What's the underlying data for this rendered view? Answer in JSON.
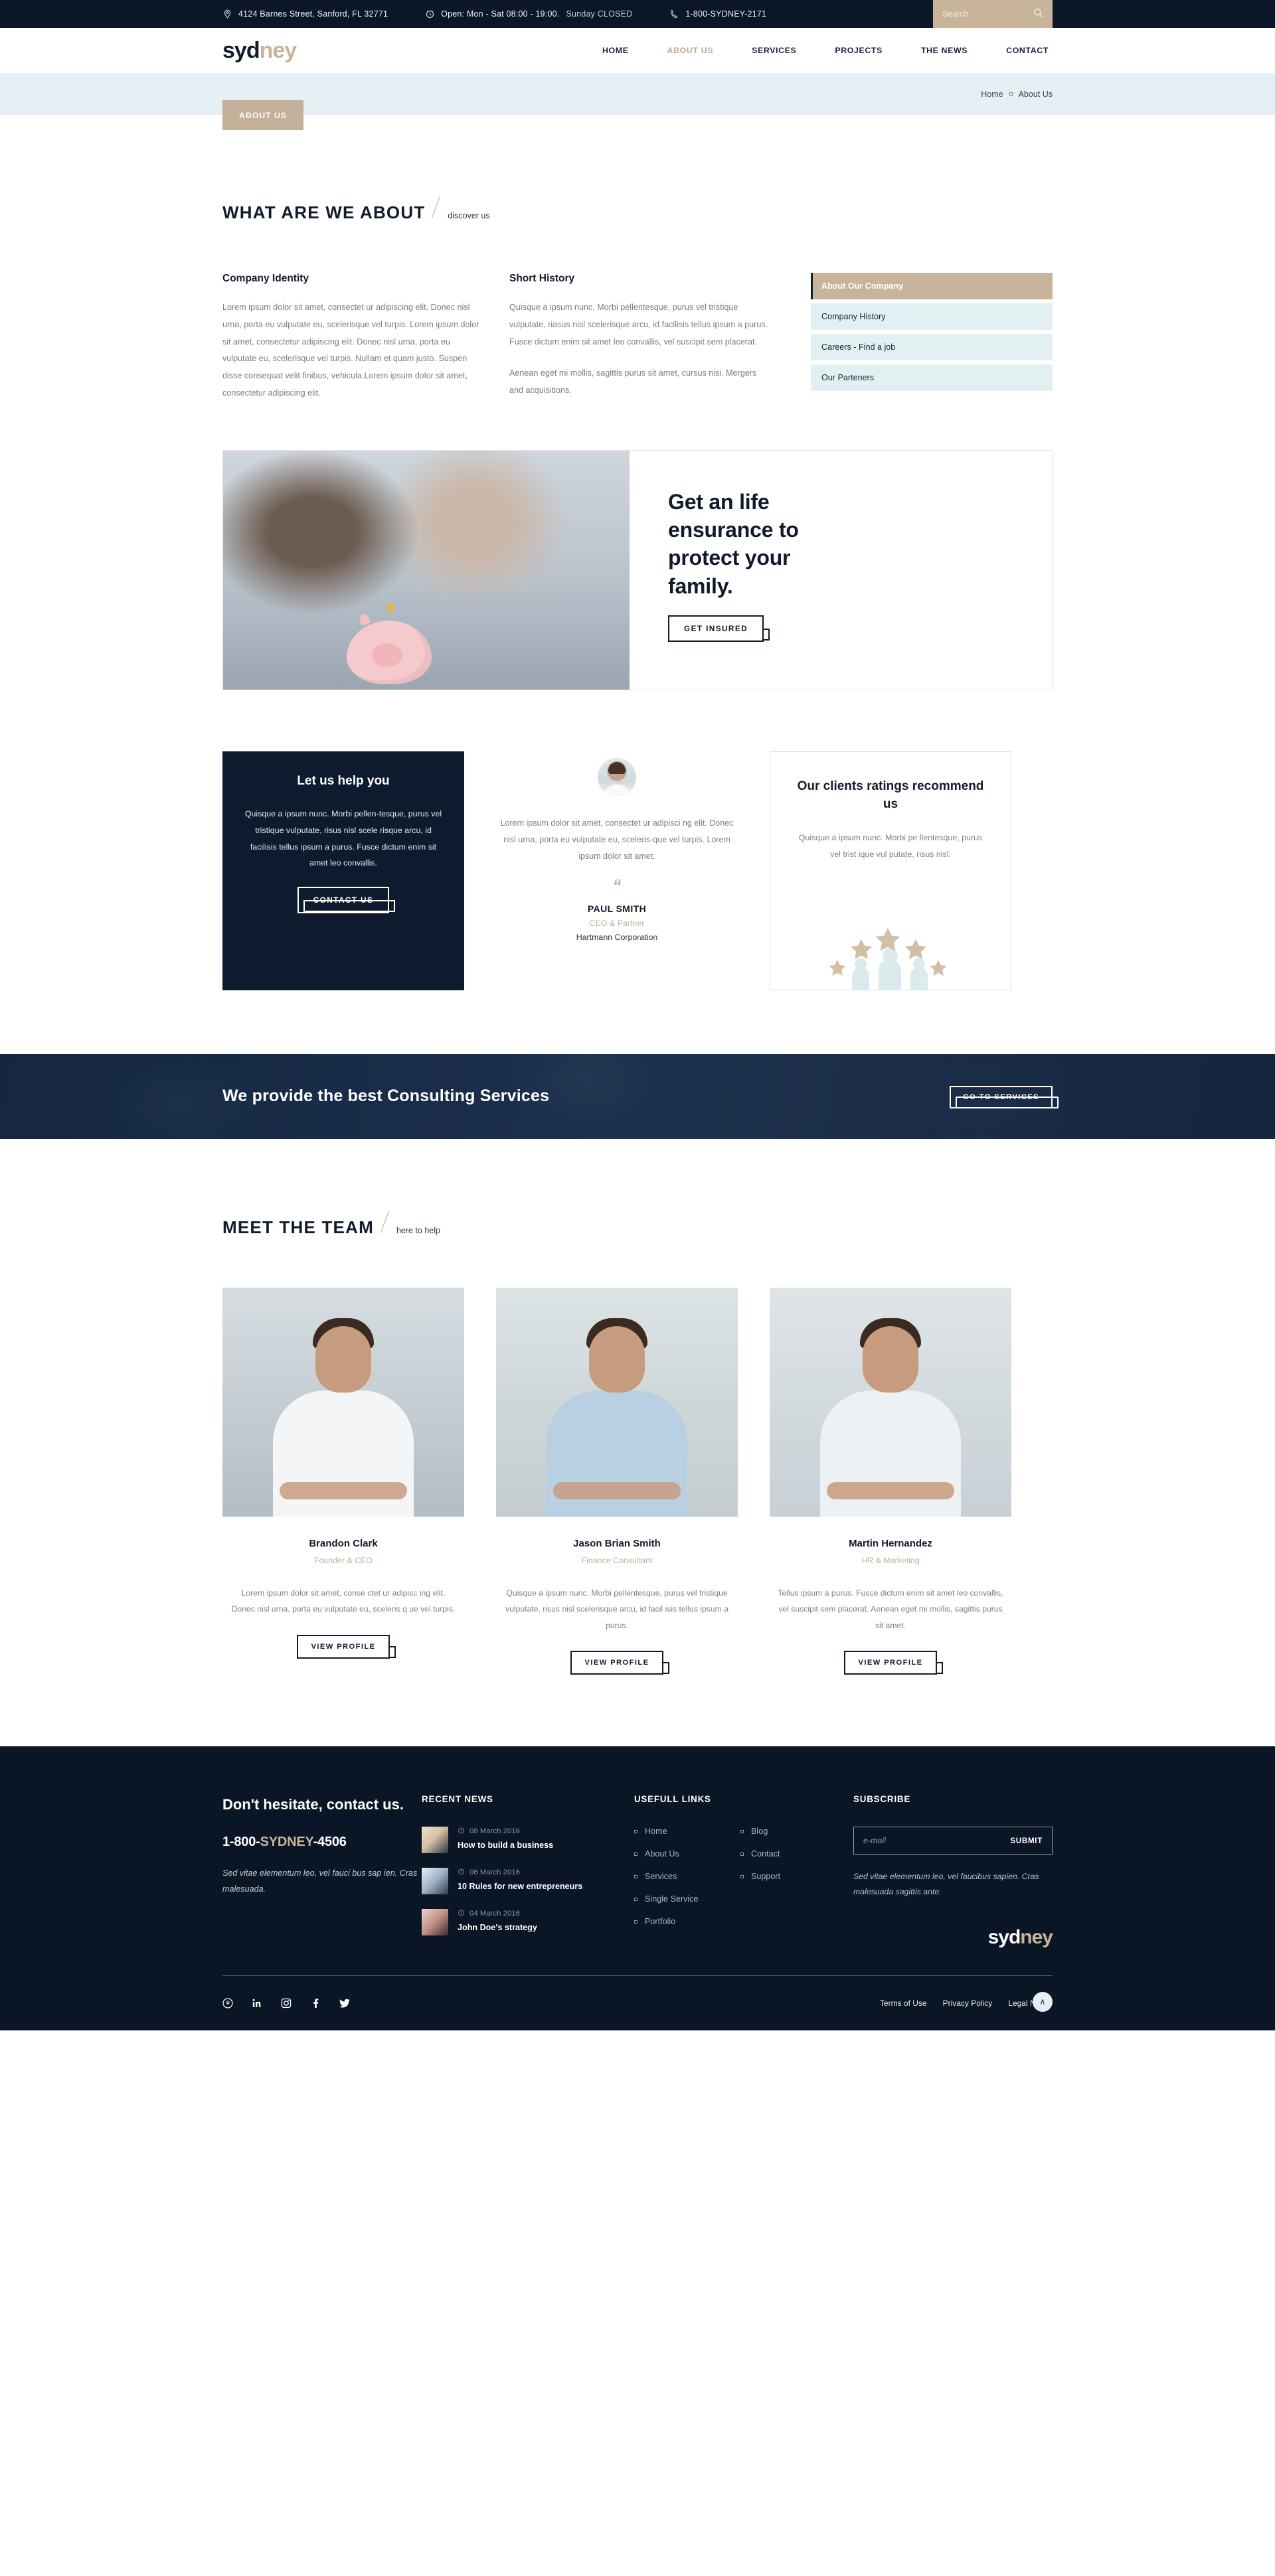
{
  "topbar": {
    "address": "4124 Barnes Street, Sanford, FL 32771",
    "hours": "Open:  Mon - Sat 08:00 - 19:00.",
    "hours_closed": "Sunday CLOSED",
    "phone": "1-800-SYDNEY-2171",
    "search_placeholder": "Search"
  },
  "brand": {
    "part1": "syd",
    "part2": "ney"
  },
  "nav": [
    {
      "label": "HOME",
      "active": false
    },
    {
      "label": "ABOUT US",
      "active": true
    },
    {
      "label": "SERVICES",
      "active": false
    },
    {
      "label": "PROJECTS",
      "active": false
    },
    {
      "label": "THE NEWS",
      "active": false
    },
    {
      "label": "CONTACT",
      "active": false
    }
  ],
  "breadcrumb": {
    "home": "Home",
    "current": "About Us",
    "tag": "ABOUT US"
  },
  "about": {
    "heading": "WHAT ARE WE ABOUT",
    "sub": "discover us",
    "col1_title": "Company Identity",
    "col1_text": "Lorem ipsum dolor sit amet, consectet ur adipiscing elit. Donec nisl urna, porta eu vulputate eu, scelerisque vel turpis.  Lorem ipsum dolor sit amet, consectetur adipiscing elit. Donec nisl urna, porta eu vulputate eu, scelerisque vel turpis. Nullam et quam justo. Suspen disse consequat velit finibus, vehicula.Lorem ipsum dolor sit amet, consectetur adipiscing elit.",
    "col2_title": "Short History",
    "col2_text_a": "Quisque a ipsum nunc. Morbi pellentesque, purus vel tristique vulputate, riasus nisl scelerisque arcu, id facilisis tellus ipsum a purus. Fusce dictum enim sit amet leo convallis, vel suscipit sem placerat.",
    "col2_text_b": "Aenean eget mi mollis, sagittis purus sit amet, cursus nisi. Mergers and acquisitions.",
    "links": [
      {
        "label": "About Our Company",
        "current": true
      },
      {
        "label": "Company History",
        "current": false
      },
      {
        "label": "Careers - Find a job",
        "current": false
      },
      {
        "label": "Our Parteners",
        "current": false
      }
    ]
  },
  "feature": {
    "title": "Get an life ensurance to protect your family.",
    "button": "GET INSURED"
  },
  "cards": {
    "help": {
      "title": "Let us help you",
      "text": "Quisque a ipsum nunc. Morbi pellen-tesque, purus vel tristique vulputate, risus nisl scele risque arcu, id facilisis tellus ipsum a purus. Fusce dictum enim sit amet leo convallis.",
      "button": "CONTACT US"
    },
    "testimonial": {
      "quote": "Lorem ipsum dolor sit amet, consectet ur adipisci ng elit. Donec nisl urna, porta eu vulputate eu, sceleris-que vel turpis. Lorem ipsum dolor sit amet.",
      "mark": "“",
      "name": "PAUL SMITH",
      "role": "CEO & Partner",
      "company": "Hartmann Corporation"
    },
    "ratings": {
      "title": "Our clients ratings recommend us",
      "text": "Quisque a ipsum nunc. Morbi pe llentesque, purus vel trist ique vul putate, risus nisl.",
      "stars": 5
    }
  },
  "consult": {
    "title": "We provide the best Consulting Services",
    "button": "GO TO SERVICES"
  },
  "team": {
    "heading": "MEET THE TEAM",
    "sub": "here to help",
    "members": [
      {
        "name": "Brandon Clark",
        "role": "Founder & CEO",
        "text": "Lorem ipsum dolor sit amet, conse ctet ur adipisc ing elit. Donec nisl urna, porta eu vulputate eu, sceleris q ue vel turpis.",
        "button": "VIEW PROFILE"
      },
      {
        "name": "Jason Brian Smith",
        "role": "Finance Consultant",
        "text": "Quisque a ipsum nunc. Morbi pellentesque, purus vel tristique vulputate, risus nisl scelerisque arcu, id facil isis tellus ipsum a purus.",
        "button": "VIEW PROFILE"
      },
      {
        "name": "Martin Hernandez",
        "role": "HR & Marketing",
        "text": "Tellus ipsum a purus. Fusce dictum enim sit amet leo convallis, vel suscipit sem placerat. Aenean eget mi mollis, sagittis purus sit amet.",
        "button": "VIEW PROFILE"
      }
    ]
  },
  "footer": {
    "cta_title": "Don't hesitate, contact us.",
    "phone_pre": "1-800-",
    "phone_hl": "SYDNEY",
    "phone_post": "-4506",
    "address": "Sed vitae elementum leo, vel fauci bus sap ien. Cras malesuada.",
    "news_title": "RECENT NEWS",
    "news": [
      {
        "date": "08 March 2016",
        "title": "How to build a business"
      },
      {
        "date": "06 March 2016",
        "title": "10 Rules for new entrepreneurs"
      },
      {
        "date": "04 March 2016",
        "title": "John Doe's strategy"
      }
    ],
    "links_title": "USEFULL LINKS",
    "links_col1": [
      "Home",
      "About Us",
      "Services",
      "Single Service",
      "Portfolio"
    ],
    "links_col2": [
      "Blog",
      "Contact",
      "Support"
    ],
    "subscribe_title": "SUBSCRIBE",
    "email_placeholder": "e-mail",
    "submit": "SUBMIT",
    "sub_note": "Sed vitae elementum leo, vel faucibus sapien. Cras malesuada sagittis ante.",
    "socials": [
      "pinterest-icon",
      "linkedin-icon",
      "instagram-icon",
      "facebook-icon",
      "twitter-icon"
    ],
    "legal": [
      "Terms of Use",
      "Privacy Policy",
      "Legal Notice"
    ],
    "to_top": "∧"
  },
  "colors": {
    "accent": "#c8b49a",
    "dark": "#0b1628",
    "band": "#e4f0f4",
    "listbg": "#e2eff3"
  }
}
